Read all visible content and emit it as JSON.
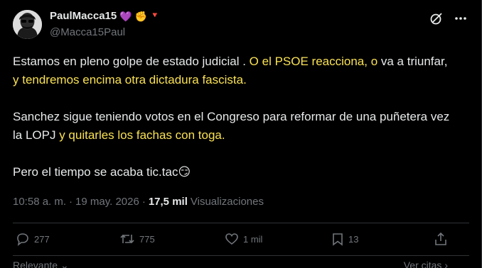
{
  "author": {
    "display_name": "PaulMacca15",
    "badges": [
      "💜",
      "✊",
      "🔻"
    ],
    "handle": "@Macca15Paul"
  },
  "post": {
    "p1_a": "Estamos en pleno golpe de estado judicial . ",
    "p1_b": "O el PSOE reacciona, o",
    "p1_c": " va a triunfar, ",
    "p1_d": "y tendremos encima otra dictadura fascista.",
    "p2_a": "Sanchez sigue teniendo votos en el Congreso para reformar de una puñetera vez la LOPJ ",
    "p2_b": "y quitarles los fachas con toga.",
    "p3_a": "Pero el tiempo se acaba tic.tac",
    "p3_emoji": "😏"
  },
  "meta": {
    "time": "10:58 a. m.",
    "sep": "·",
    "date": "19 may. 2026",
    "sep2": "·",
    "views": "17,5 mil",
    "views_label": "Visualizaciones"
  },
  "actions": {
    "replies": "277",
    "reposts": "775",
    "likes": "1 mil",
    "bookmarks": "13"
  },
  "footer": {
    "left": "Relevante",
    "right": "Ver citas"
  },
  "icons": [
    "grok-icon",
    "more-icon",
    "reply-icon",
    "repost-icon",
    "like-icon",
    "bookmark-icon",
    "share-icon",
    "chevron-down-icon"
  ],
  "colors": {
    "highlight": "#f9e154",
    "muted": "#71767b",
    "text": "#e7e9ea"
  }
}
